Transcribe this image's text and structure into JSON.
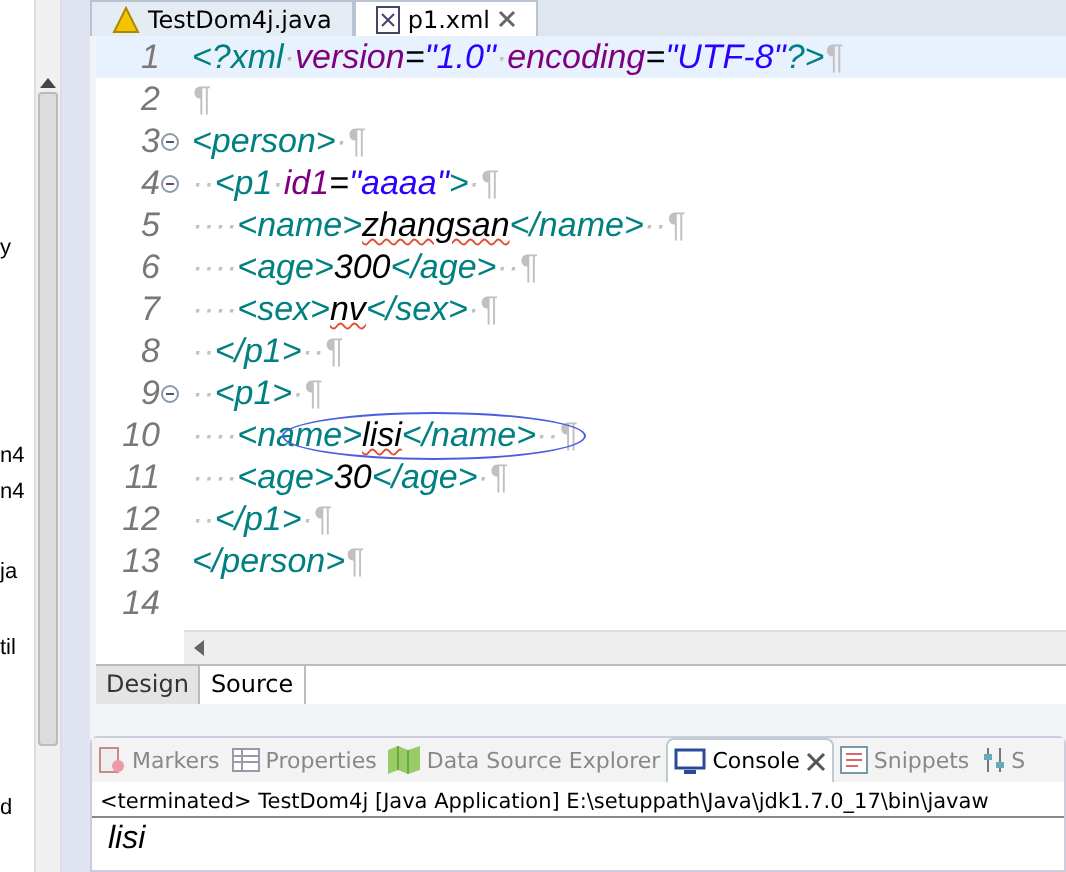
{
  "sidebar": {
    "items": [
      {
        "text": "y"
      },
      {
        "text": "n4"
      },
      {
        "text": "n4"
      },
      {
        "text": "ja"
      },
      {
        "text": "til"
      },
      {
        "text": "d"
      }
    ]
  },
  "editor_tabs": [
    {
      "label": "TestDom4j.java",
      "kind": "java",
      "selected": false
    },
    {
      "label": "p1.xml",
      "kind": "xml",
      "selected": true
    }
  ],
  "lines": [
    {
      "number": "1",
      "fold": false,
      "current": true,
      "tokens": [
        {
          "kind": "tag",
          "text": "<?xml"
        },
        {
          "kind": "space",
          "text": "·"
        },
        {
          "kind": "attr",
          "text": "version"
        },
        {
          "kind": "plain",
          "text": "="
        },
        {
          "kind": "value",
          "text": "\"1.0\""
        },
        {
          "kind": "space",
          "text": "·"
        },
        {
          "kind": "attr",
          "text": "encoding"
        },
        {
          "kind": "plain",
          "text": "="
        },
        {
          "kind": "value",
          "text": "\"UTF-8\""
        },
        {
          "kind": "tag",
          "text": "?>"
        },
        {
          "kind": "eol",
          "text": "¶"
        }
      ]
    },
    {
      "number": "2",
      "fold": false,
      "current": false,
      "tokens": [
        {
          "kind": "eol",
          "text": "¶"
        }
      ]
    },
    {
      "number": "3",
      "fold": true,
      "current": false,
      "tokens": [
        {
          "kind": "tag",
          "text": "<person>"
        },
        {
          "kind": "space",
          "text": "·"
        },
        {
          "kind": "eol",
          "text": "¶"
        }
      ]
    },
    {
      "number": "4",
      "fold": true,
      "current": false,
      "tokens": [
        {
          "kind": "space",
          "text": "··"
        },
        {
          "kind": "tag",
          "text": "<p1"
        },
        {
          "kind": "space",
          "text": "·"
        },
        {
          "kind": "attr",
          "text": "id1"
        },
        {
          "kind": "plain",
          "text": "="
        },
        {
          "kind": "value",
          "text": "\"aaaa\""
        },
        {
          "kind": "tag",
          "text": ">"
        },
        {
          "kind": "space",
          "text": "·"
        },
        {
          "kind": "eol",
          "text": "¶"
        }
      ]
    },
    {
      "number": "5",
      "fold": false,
      "current": false,
      "tokens": [
        {
          "kind": "space",
          "text": "····"
        },
        {
          "kind": "tag",
          "text": "<name>"
        },
        {
          "kind": "plain",
          "text": "zhangsan",
          "misspelled": true
        },
        {
          "kind": "tag",
          "text": "</name>"
        },
        {
          "kind": "space",
          "text": "··"
        },
        {
          "kind": "eol",
          "text": "¶"
        }
      ]
    },
    {
      "number": "6",
      "fold": false,
      "current": false,
      "tokens": [
        {
          "kind": "space",
          "text": "····"
        },
        {
          "kind": "tag",
          "text": "<age>"
        },
        {
          "kind": "plain",
          "text": "300"
        },
        {
          "kind": "tag",
          "text": "</age>"
        },
        {
          "kind": "space",
          "text": "··"
        },
        {
          "kind": "eol",
          "text": "¶"
        }
      ]
    },
    {
      "number": "7",
      "fold": false,
      "current": false,
      "tokens": [
        {
          "kind": "space",
          "text": "····"
        },
        {
          "kind": "tag",
          "text": "<sex>"
        },
        {
          "kind": "plain",
          "text": "nv",
          "misspelled": true
        },
        {
          "kind": "tag",
          "text": "</sex>"
        },
        {
          "kind": "space",
          "text": "·"
        },
        {
          "kind": "eol",
          "text": "¶"
        }
      ]
    },
    {
      "number": "8",
      "fold": false,
      "current": false,
      "tokens": [
        {
          "kind": "space",
          "text": "··"
        },
        {
          "kind": "tag",
          "text": "</p1>"
        },
        {
          "kind": "space",
          "text": "··"
        },
        {
          "kind": "eol",
          "text": "¶"
        }
      ]
    },
    {
      "number": "9",
      "fold": true,
      "current": false,
      "tokens": [
        {
          "kind": "space",
          "text": "··"
        },
        {
          "kind": "tag",
          "text": "<p1>"
        },
        {
          "kind": "space",
          "text": "·"
        },
        {
          "kind": "eol",
          "text": "¶"
        }
      ]
    },
    {
      "number": "10",
      "fold": false,
      "current": false,
      "circled": true,
      "tokens": [
        {
          "kind": "space",
          "text": "····"
        },
        {
          "kind": "tag",
          "text": "<name>"
        },
        {
          "kind": "plain",
          "text": "lisi",
          "misspelled": true
        },
        {
          "kind": "tag",
          "text": "</name>"
        },
        {
          "kind": "space",
          "text": "··"
        },
        {
          "kind": "eol",
          "text": "¶"
        }
      ]
    },
    {
      "number": "11",
      "fold": false,
      "current": false,
      "tokens": [
        {
          "kind": "space",
          "text": "····"
        },
        {
          "kind": "tag",
          "text": "<age>"
        },
        {
          "kind": "plain",
          "text": "30"
        },
        {
          "kind": "tag",
          "text": "</age>"
        },
        {
          "kind": "space",
          "text": "·"
        },
        {
          "kind": "eol",
          "text": "¶"
        }
      ]
    },
    {
      "number": "12",
      "fold": false,
      "current": false,
      "tokens": [
        {
          "kind": "space",
          "text": "··"
        },
        {
          "kind": "tag",
          "text": "</p1>"
        },
        {
          "kind": "space",
          "text": "·"
        },
        {
          "kind": "eol",
          "text": "¶"
        }
      ]
    },
    {
      "number": "13",
      "fold": false,
      "current": false,
      "tokens": [
        {
          "kind": "tag",
          "text": "</person>"
        },
        {
          "kind": "eol",
          "text": "¶"
        }
      ]
    },
    {
      "number": "14",
      "fold": false,
      "current": false
    }
  ],
  "page_tabs": [
    {
      "label": "Design",
      "selected": false
    },
    {
      "label": "Source",
      "selected": true
    }
  ],
  "view_tabs": [
    {
      "label": "Markers",
      "kind": "markers",
      "selected": false
    },
    {
      "label": "Properties",
      "kind": "properties",
      "selected": false
    },
    {
      "label": "Data Source Explorer",
      "kind": "datasource",
      "selected": false
    },
    {
      "label": "Console",
      "kind": "console",
      "selected": true
    },
    {
      "label": "Snippets",
      "kind": "snippets",
      "selected": false
    },
    {
      "label": "S",
      "kind": "sliders",
      "selected": false
    }
  ],
  "console": {
    "header": "<terminated> TestDom4j [Java Application] E:\\setuppath\\Java\\jdk1.7.0_17\\bin\\javaw",
    "output": "lisi"
  }
}
